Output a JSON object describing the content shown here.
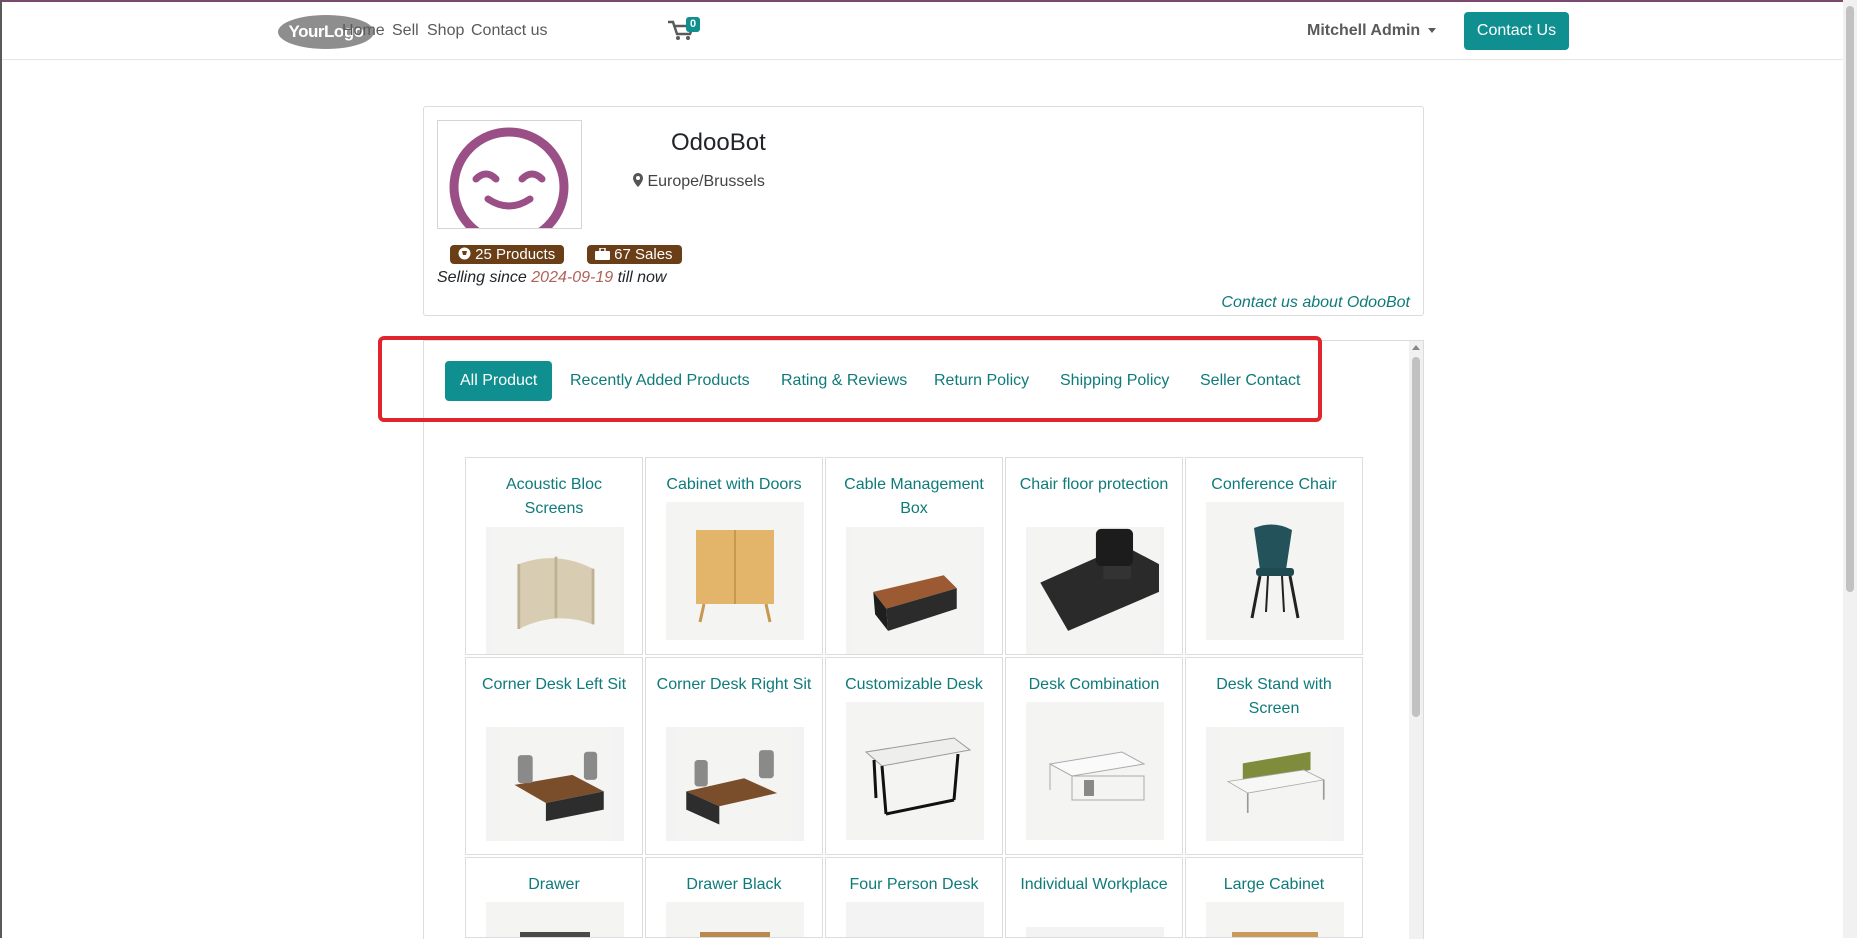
{
  "header": {
    "logo_text": "YourLogo",
    "nav": [
      "Home",
      "Sell",
      "Shop",
      "Contact us"
    ],
    "cart_count": "0",
    "user_name": "Mitchell Admin",
    "contact_button": "Contact Us"
  },
  "profile": {
    "name": "OdooBot",
    "location": "Europe/Brussels",
    "products_badge": "25 Products",
    "sales_badge": "67 Sales",
    "since_prefix": "Selling since",
    "since_date": "2024-09-19",
    "since_suffix": "till now",
    "contact_link": "Contact us about OdooBot"
  },
  "tabs": [
    {
      "label": "All Product",
      "active": true
    },
    {
      "label": "Recently Added Products",
      "active": false
    },
    {
      "label": "Rating & Reviews",
      "active": false
    },
    {
      "label": "Return Policy",
      "active": false
    },
    {
      "label": "Shipping Policy",
      "active": false
    },
    {
      "label": "Seller Contact",
      "active": false
    }
  ],
  "products": [
    "Acoustic Bloc Screens",
    "Cabinet with Doors",
    "Cable Management Box",
    "Chair floor protection",
    "Conference Chair",
    "Corner Desk Left Sit",
    "Corner Desk Right Sit",
    "Customizable Desk",
    "Desk Combination",
    "Desk Stand with Screen",
    "Drawer",
    "Drawer Black",
    "Four Person Desk",
    "Individual Workplace",
    "Large Cabinet"
  ],
  "colors": {
    "accent": "#0f8f8f",
    "badge": "#6a3e16",
    "highlight": "#e0262d"
  }
}
